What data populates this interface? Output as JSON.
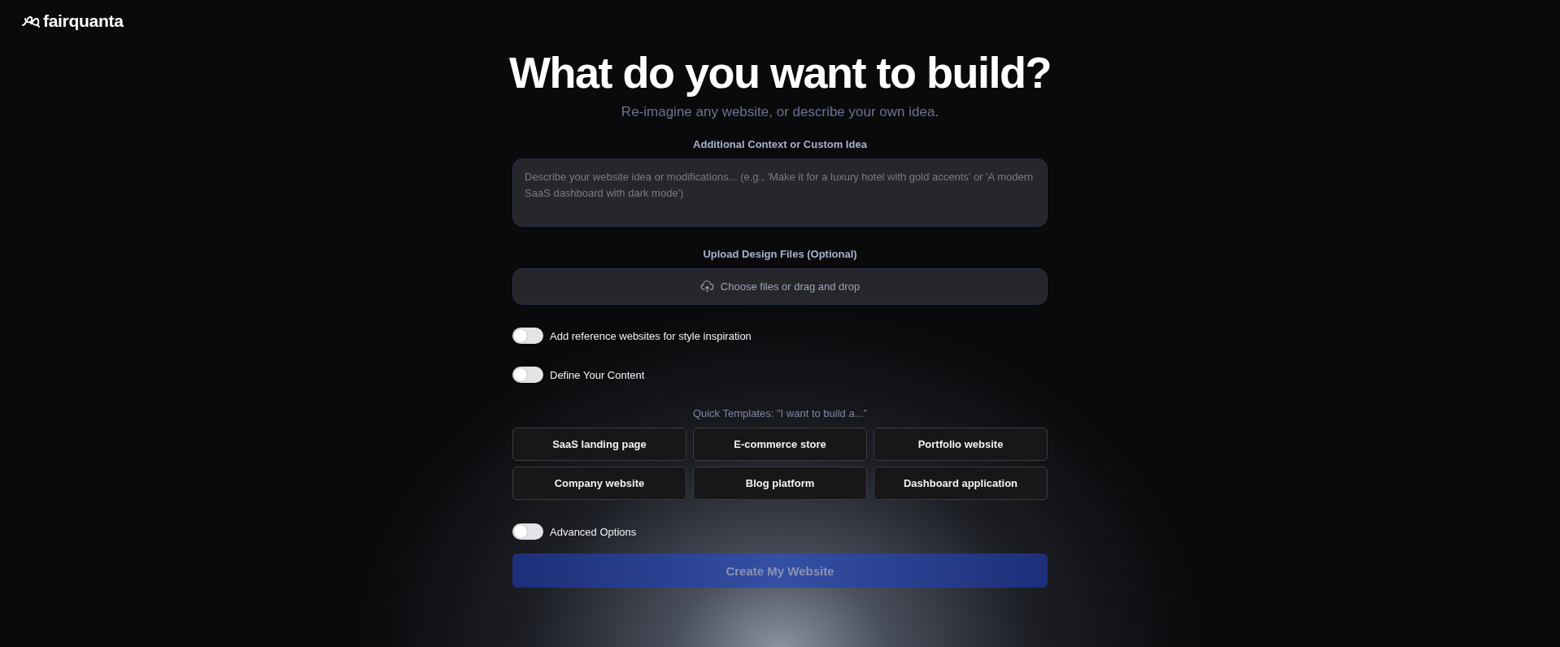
{
  "brand": {
    "name": "fairquanta"
  },
  "hero": {
    "title": "What do you want to build?",
    "subtitle": "Re-imagine any website, or describe your own idea."
  },
  "context": {
    "label": "Additional Context or Custom Idea",
    "placeholder": "Describe your website idea or modifications... (e.g., 'Make it for a luxury hotel with gold accents' or 'A modern SaaS dashboard with dark mode')"
  },
  "upload": {
    "label": "Upload Design Files (Optional)",
    "button": "Choose files or drag and drop"
  },
  "options": [
    {
      "label": "Add reference websites for style inspiration",
      "on": false
    },
    {
      "label": "Define Your Content",
      "on": false
    }
  ],
  "templates": {
    "heading": "Quick Templates: \"I want to build a...\"",
    "items": [
      "SaaS landing page",
      "E-commerce store",
      "Portfolio website",
      "Company website",
      "Blog platform",
      "Dashboard application"
    ]
  },
  "advanced": {
    "label": "Advanced Options",
    "on": false
  },
  "submit": {
    "label": "Create My Website",
    "disabled": true
  }
}
